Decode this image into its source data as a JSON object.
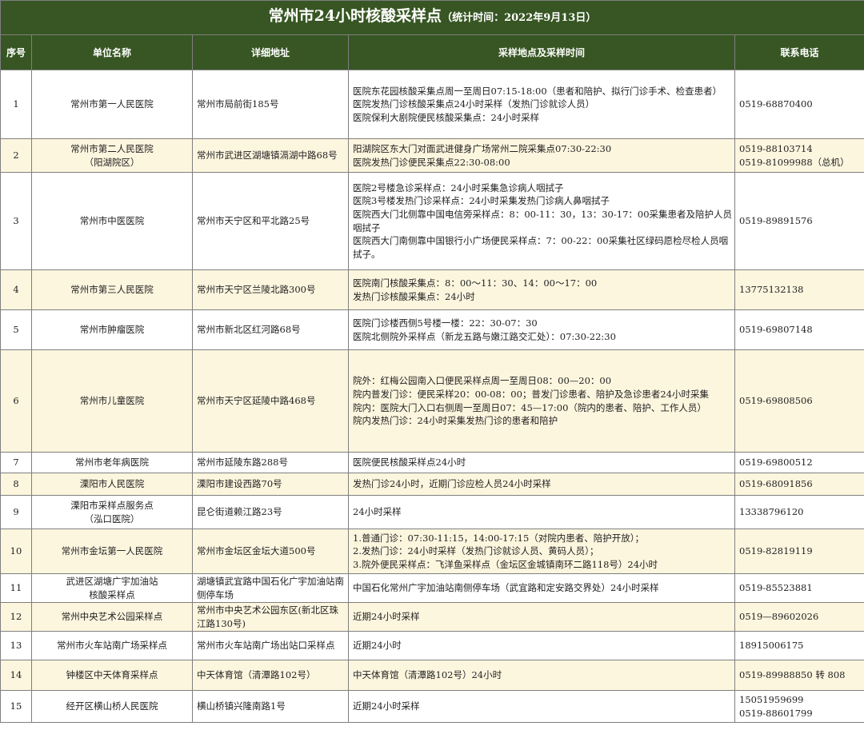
{
  "title": "常州市24小时核酸采样点",
  "subtitle": "（统计时间：2022年9月13日）",
  "headers": [
    "序号",
    "单位名称",
    "详细地址",
    "采样地点及采样时间",
    "联系电话"
  ],
  "rows": [
    {
      "no": "1",
      "name": [
        "常州市第一人民医院"
      ],
      "address": [
        "常州市局前街185号"
      ],
      "details": [
        "医院东花园核酸采集点周一至周日07:15-18:00（患者和陪护、拟行门诊手术、检查患者）",
        "医院发热门诊核酸采集点24小时采样（发热门诊就诊人员）",
        "医院保利大剧院便民核酸采集点：24小时采样"
      ],
      "phone": [
        "0519-68870400"
      ]
    },
    {
      "no": "2",
      "name": [
        "常州市第二人民医院",
        "（阳湖院区）"
      ],
      "address": [
        "常州市武进区湖塘镇滆湖中路68号"
      ],
      "details": [
        "阳湖院区东大门对面武进健身广场常州二院采集点07:30-22:30",
        "医院发热门诊便民采集点22:30-08:00"
      ],
      "phone": [
        "0519-88103714",
        "0519-81099988（总机）"
      ]
    },
    {
      "no": "3",
      "name": [
        "常州市中医医院"
      ],
      "address": [
        "常州市天宁区和平北路25号"
      ],
      "details": [
        "医院2号楼急诊采样点：24小时采集急诊病人咽拭子",
        "医院3号楼发热门诊采样点：24小时采集发热门诊病人鼻咽拭子",
        "医院西大门北侧靠中国电信旁采样点：8：00-11：30，13：30-17：00采集患者及陪护人员咽拭子",
        "医院西大门南侧靠中国银行小广场便民采样点：7：00-22：00采集社区绿码愿检尽检人员咽拭子。"
      ],
      "phone": [
        "0519-89891576"
      ]
    },
    {
      "no": "4",
      "name": [
        "常州市第三人民医院"
      ],
      "address": [
        "常州市天宁区兰陵北路300号"
      ],
      "details": [
        "医院南门核酸采集点：8：00～11：30、14：00～17：00",
        "发热门诊核酸采集点：24小时"
      ],
      "phone": [
        "13775132138"
      ]
    },
    {
      "no": "5",
      "name": [
        "常州市肿瘤医院"
      ],
      "address": [
        "常州市新北区红河路68号"
      ],
      "details": [
        "医院门诊楼西侧5号楼一楼：22：30-07：30",
        "医院北侧院外采样点（新龙五路与嫩江路交汇处）：07:30-22:30"
      ],
      "phone": [
        "0519-69807148"
      ]
    },
    {
      "no": "6",
      "name": [
        "常州市儿童医院"
      ],
      "address": [
        "常州市天宁区延陵中路468号"
      ],
      "details": [
        "院外：红梅公园南入口便民采样点周一至周日08：00—20：00",
        "院内普发门诊：便民采样20：00-08：00；普发门诊患者、陪护及急诊患者24小时采集",
        "院内：医院大门入口右侧周一至周日07：45—17:00（院内的患者、陪护、工作人员）",
        "院内发热门诊：24小时采集发热门诊的患者和陪护"
      ],
      "phone": [
        "0519-69808506"
      ]
    },
    {
      "no": "7",
      "name": [
        "常州市老年病医院"
      ],
      "address": [
        "常州市延陵东路288号"
      ],
      "details": [
        "医院便民核酸采样点24小时"
      ],
      "phone": [
        "0519-69800512"
      ]
    },
    {
      "no": "8",
      "name": [
        "溧阳市人民医院"
      ],
      "address": [
        "溧阳市建设西路70号"
      ],
      "details": [
        "发热门诊24小时，近期门诊应检人员24小时采样"
      ],
      "phone": [
        "0519-68091856"
      ]
    },
    {
      "no": "9",
      "name": [
        "溧阳市采样点服务点",
        "（泓口医院）"
      ],
      "address": [
        "昆仑街道赖江路23号"
      ],
      "details": [
        "24小时采样"
      ],
      "phone": [
        "13338796120"
      ]
    },
    {
      "no": "10",
      "name": [
        "常州市金坛第一人民医院"
      ],
      "address": [
        "常州市金坛区金坛大道500号"
      ],
      "details": [
        "1.普通门诊：07:30-11:15，14:00-17:15（对院内患者、陪护开放）；",
        "2.发热门诊：24小时采样（发热门诊就诊人员、黄码人员）；",
        "3.院外便民采样点：飞洋鱼采样点（金坛区金城镇南环二路118号）24小时"
      ],
      "phone": [
        "0519-82819119"
      ]
    },
    {
      "no": "11",
      "name": [
        "武进区湖塘广宇加油站",
        "核酸采样点"
      ],
      "address": [
        "湖塘镇武宜路中国石化广宇加油站南侧停车场"
      ],
      "details": [
        "中国石化常州广宇加油站南侧停车场（武宜路和定安路交界处）24小时采样"
      ],
      "phone": [
        "0519-85523881"
      ]
    },
    {
      "no": "12",
      "name": [
        "常州中央艺术公园采样点"
      ],
      "address": [
        "常州市中央艺术公园东区(新北区珠江路130号)"
      ],
      "details": [
        "近期24小时采样"
      ],
      "phone": [
        "0519—89602026"
      ]
    },
    {
      "no": "13",
      "name": [
        "常州市火车站南广场采样点"
      ],
      "address": [
        "常州市火车站南广场出站口采样点"
      ],
      "details": [
        "近期24小时"
      ],
      "phone": [
        "18915006175"
      ]
    },
    {
      "no": "14",
      "name": [
        "钟楼区中天体育采样点"
      ],
      "address": [
        "中天体育馆（清潭路102号）"
      ],
      "details": [
        "中天体育馆（清潭路102号）24小时"
      ],
      "phone": [
        "0519-89988850 转 808"
      ]
    },
    {
      "no": "15",
      "name": [
        "经开区横山桥人民医院"
      ],
      "address": [
        "横山桥镇兴隆南路1号"
      ],
      "details": [
        "近期24小时采样"
      ],
      "phone": [
        "15051959699",
        "0519-88601799"
      ]
    }
  ]
}
